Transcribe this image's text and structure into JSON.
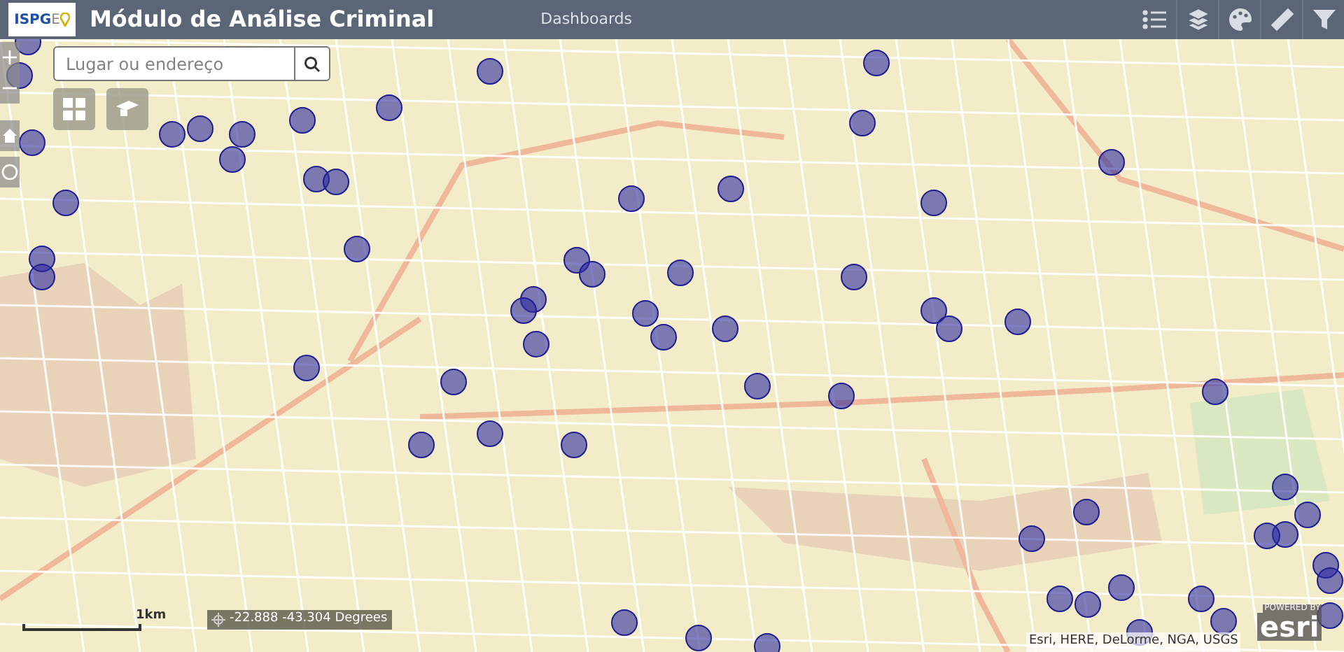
{
  "header": {
    "logo": {
      "text_1": "ISPG",
      "text_2": "E"
    },
    "title": "Módulo de Análise Criminal",
    "nav_link": "Dashboards"
  },
  "search": {
    "placeholder": "Lugar ou endereço"
  },
  "zoom": {
    "in": "+",
    "out": "−"
  },
  "scale_bar": {
    "label": "1km"
  },
  "coordinates": {
    "text": "-22.888 -43.304 Degrees"
  },
  "attribution": "Esri, HERE, DeLorme, NGA, USGS",
  "esri_logo": {
    "powered": "POWERED BY",
    "brand": "esri"
  }
}
